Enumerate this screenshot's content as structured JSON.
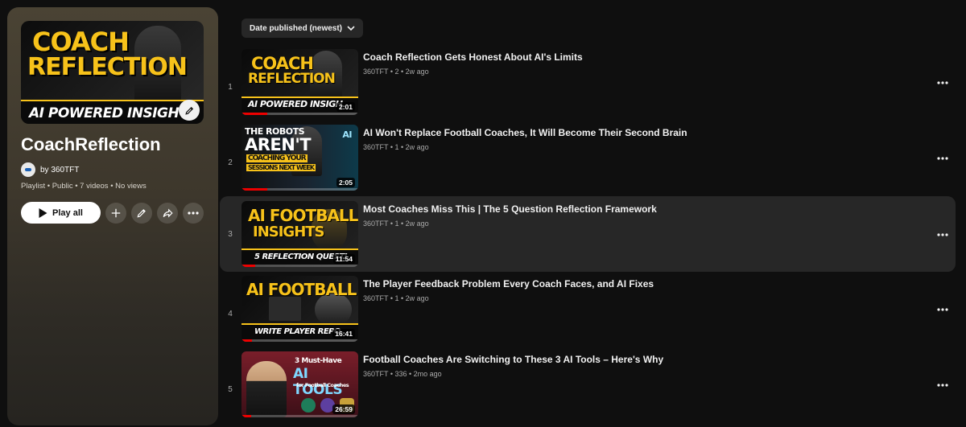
{
  "playlist": {
    "cover_text_line1": "COACH",
    "cover_text_line2": "REFLECTION",
    "cover_banner": "AI POWERED INSIGHT",
    "title": "CoachReflection",
    "owner": "by 360TFT",
    "meta": "Playlist • Public • 7 videos • No views",
    "play_all": "Play all"
  },
  "sort": {
    "label": "Date published (newest)"
  },
  "videos": [
    {
      "index": "1",
      "title": "Coach Reflection Gets Honest About AI's Limits",
      "meta": "360TFT • 2 • 2w ago",
      "duration": "2:01",
      "thumb_l1": "COACH",
      "thumb_l2": "REFLECTION",
      "thumb_banner": "AI POWERED INSIGH"
    },
    {
      "index": "2",
      "title": "AI Won't Replace Football Coaches, It Will Become Their Second Brain",
      "meta": "360TFT • 1 • 2w ago",
      "duration": "2:05",
      "thumb_l1": "THE ROBOTS",
      "thumb_l2": "AREN'T",
      "thumb_l3": "COACHING YOUR",
      "thumb_l4": "SESSIONS NEXT WEEK",
      "thumb_badge": "AI"
    },
    {
      "index": "3",
      "title": "Most Coaches Miss This | The 5 Question Reflection Framework",
      "meta": "360TFT • 1 • 2w ago",
      "duration": "11:54",
      "thumb_l1": "AI FOOTBALL",
      "thumb_l2": "INSIGHTS",
      "thumb_banner": "5 REFLECTION QUESTI"
    },
    {
      "index": "4",
      "title": "The Player Feedback Problem Every Coach Faces, and AI Fixes",
      "meta": "360TFT • 1 • 2w ago",
      "duration": "16:41",
      "thumb_l1": "AI FOOTBALL",
      "thumb_banner": "WRITE PLAYER REPO"
    },
    {
      "index": "5",
      "title": "Football Coaches Are Switching to These 3 AI Tools – Here's Why",
      "meta": "360TFT • 336 • 2mo ago",
      "duration": "26:59",
      "thumb_l1": "3 Must-Have",
      "thumb_l2": "AI TOOLS",
      "thumb_l3": "for Football Coaches"
    }
  ],
  "colors": {
    "accent_yellow": "#f7c21a",
    "progress_red": "#ee0000",
    "row_highlight": "#272727"
  },
  "icons": [
    "play-icon",
    "plus-icon",
    "pencil-icon",
    "share-icon",
    "more-horizontal-icon",
    "chevron-down-icon",
    "more-vertical-icon"
  ]
}
